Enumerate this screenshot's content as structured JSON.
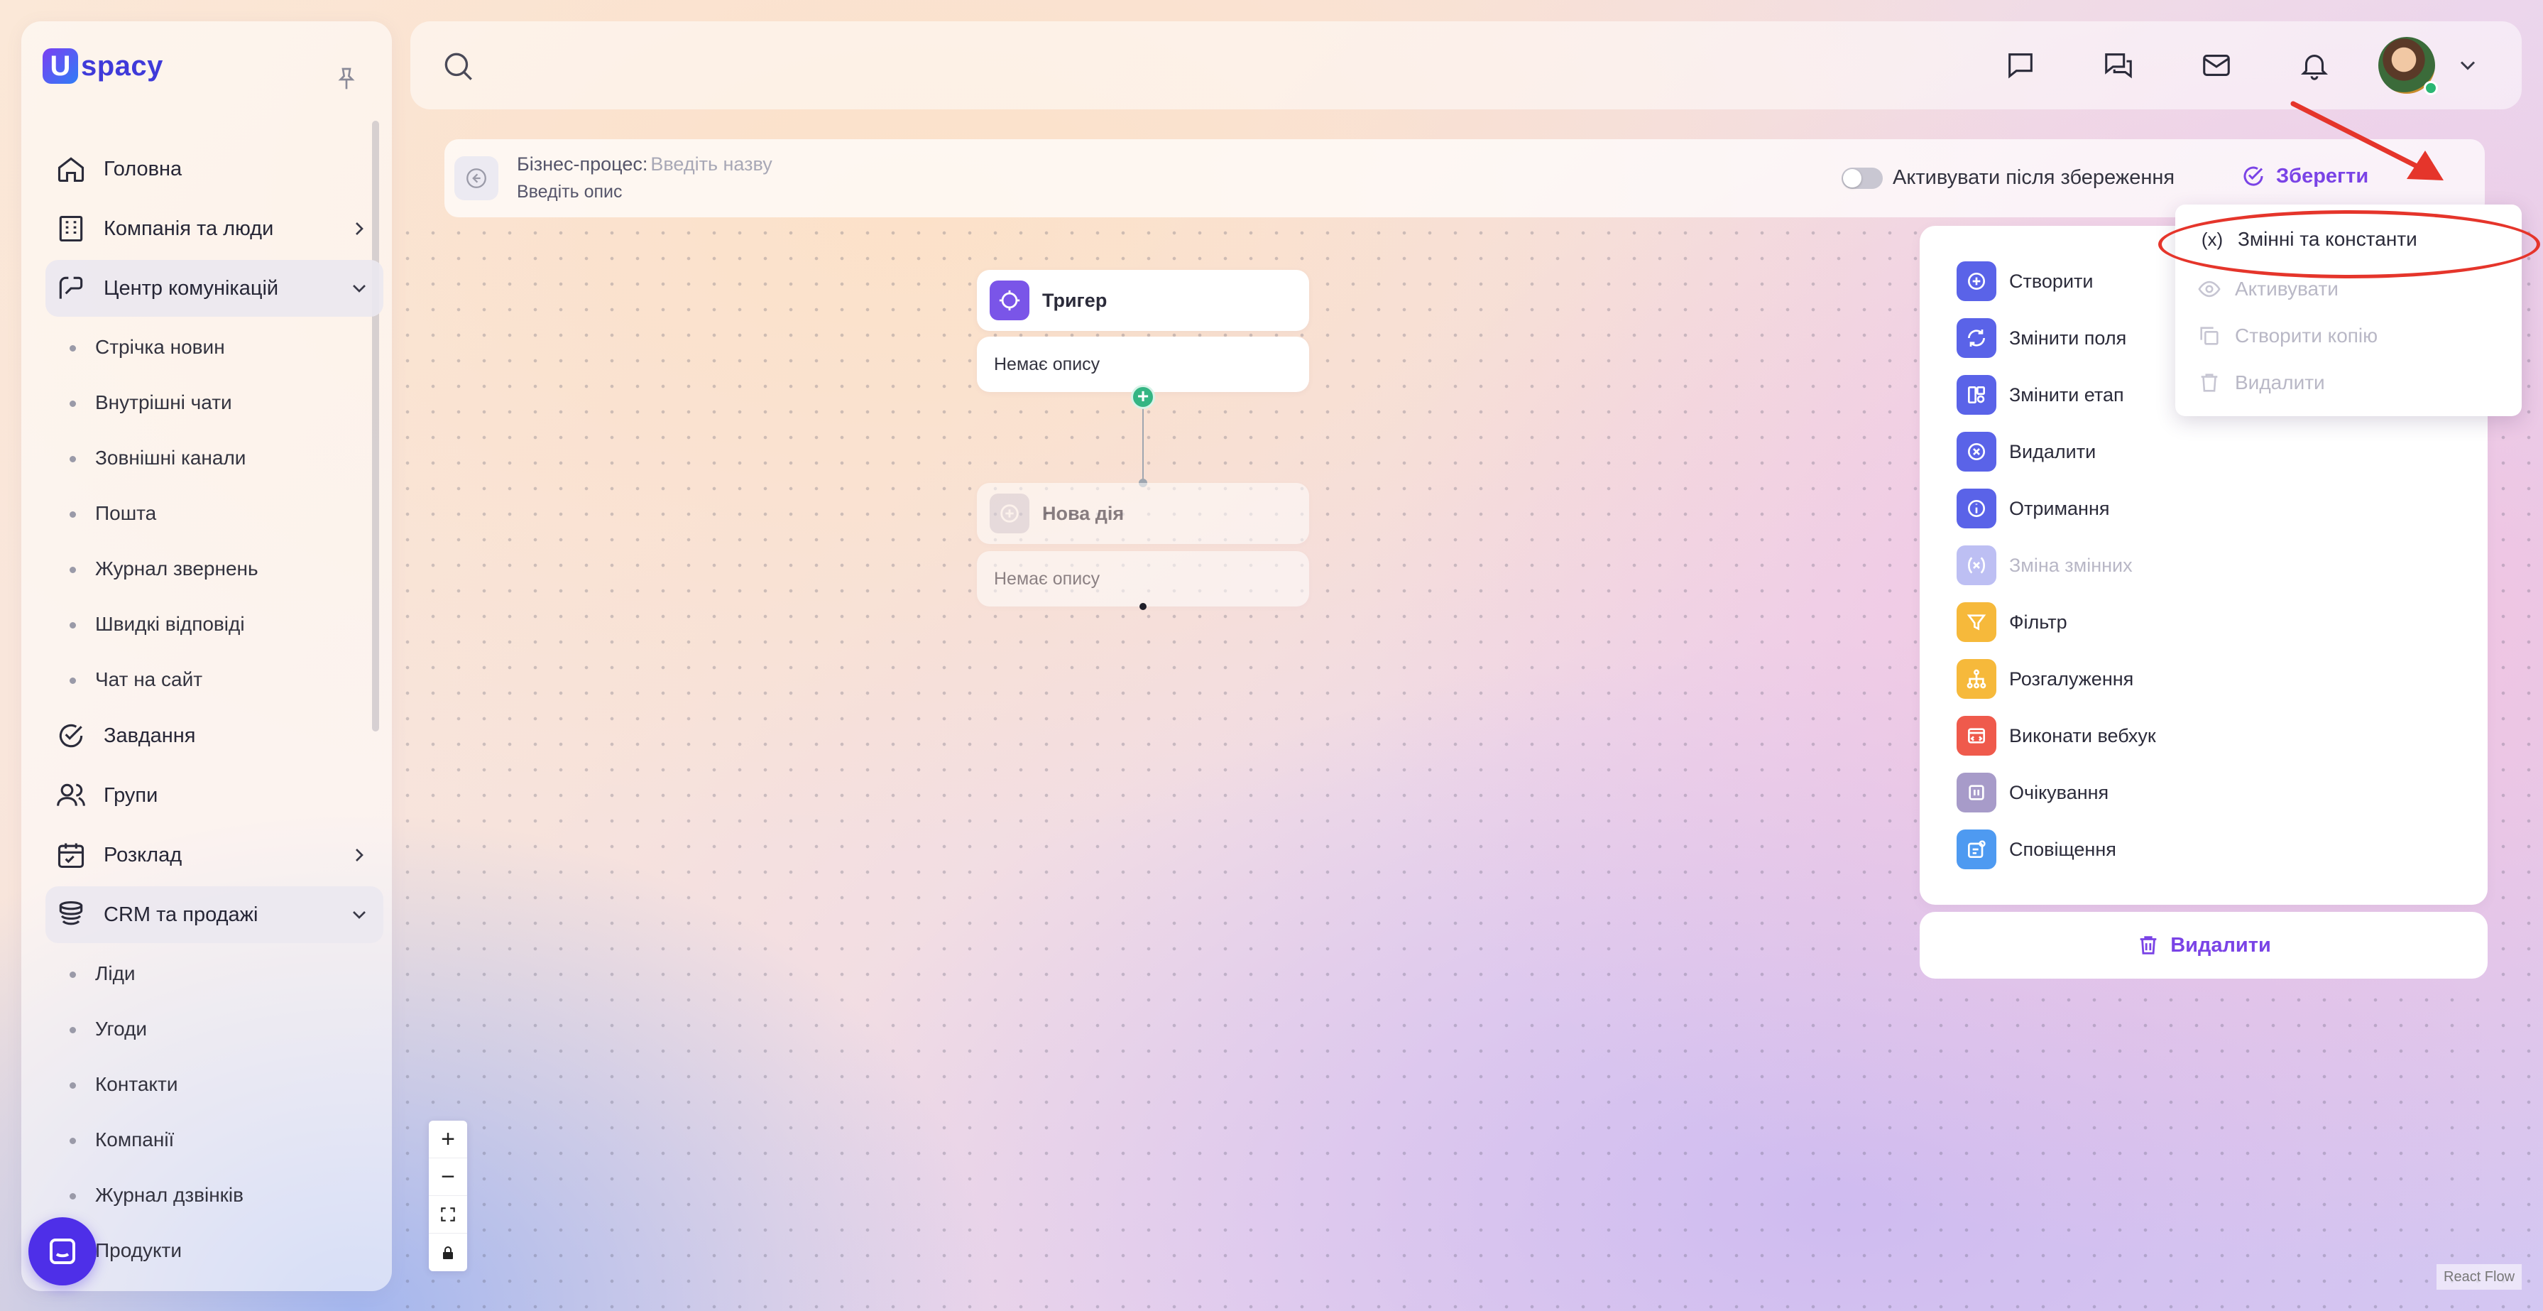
{
  "app": {
    "logo_text": "spacy",
    "logo_letter": "U"
  },
  "sidebar": {
    "items": [
      {
        "label": "Головна",
        "icon": "home-icon"
      },
      {
        "label": "Компанія та люди",
        "icon": "building-icon",
        "expandable": true
      },
      {
        "label": "Центр комунікацій",
        "icon": "communication-icon",
        "expanded": true
      },
      {
        "label": "Стрічка новин",
        "sub": true
      },
      {
        "label": "Внутрішні чати",
        "sub": true
      },
      {
        "label": "Зовнішні канали",
        "sub": true
      },
      {
        "label": "Пошта",
        "sub": true
      },
      {
        "label": "Журнал звернень",
        "sub": true
      },
      {
        "label": "Швидкі відповіді",
        "sub": true
      },
      {
        "label": "Чат на сайт",
        "sub": true
      },
      {
        "label": "Завдання",
        "icon": "task-check-icon"
      },
      {
        "label": "Групи",
        "icon": "group-icon"
      },
      {
        "label": "Розклад",
        "icon": "calendar-icon",
        "expandable": true
      },
      {
        "label": "CRM та продажі",
        "icon": "coins-icon",
        "expanded": true
      },
      {
        "label": "Ліди",
        "sub": true
      },
      {
        "label": "Угоди",
        "sub": true
      },
      {
        "label": "Контакти",
        "sub": true
      },
      {
        "label": "Компанії",
        "sub": true
      },
      {
        "label": "Журнал дзвінків",
        "sub": true
      },
      {
        "label": "Продукти",
        "sub": true
      }
    ]
  },
  "process": {
    "label": "Бізнес-процес:",
    "name_placeholder": "Введіть назву",
    "description_placeholder": "Введіть опис",
    "activate_toggle_label": "Активувати після збереження",
    "save_label": "Зберегти"
  },
  "flow": {
    "trigger": {
      "title": "Тригер",
      "description": "Немає опису"
    },
    "new_action": {
      "title": "Нова дія",
      "description": "Немає опису"
    }
  },
  "actions_panel": {
    "items": [
      {
        "label": "Створити",
        "icon": "plus-circle-icon",
        "color": "#5a63e8"
      },
      {
        "label": "Змінити поля",
        "icon": "refresh-icon",
        "color": "#5a63e8"
      },
      {
        "label": "Змінити етап",
        "icon": "stage-icon",
        "color": "#5a63e8"
      },
      {
        "label": "Видалити",
        "icon": "x-circle-icon",
        "color": "#5a63e8"
      },
      {
        "label": "Отримання",
        "icon": "info-icon",
        "color": "#5a63e8"
      },
      {
        "label": "Зміна змінних",
        "icon": "variable-icon",
        "color": "#bdbff3",
        "disabled": true
      },
      {
        "label": "Фільтр",
        "icon": "filter-icon",
        "color": "#f6b93b"
      },
      {
        "label": "Розгалуження",
        "icon": "branch-icon",
        "color": "#f6b93b"
      },
      {
        "label": "Виконати вебхук",
        "icon": "webhook-icon",
        "color": "#ef5a4c"
      },
      {
        "label": "Очікування",
        "icon": "pause-icon",
        "color": "#a79bc9"
      },
      {
        "label": "Сповіщення",
        "icon": "notification-icon",
        "color": "#4e9af1"
      }
    ],
    "delete_label": "Видалити"
  },
  "menu": {
    "items": [
      {
        "label": "Змінні та константи",
        "icon": "(x)"
      },
      {
        "label": "Активувати",
        "icon": "eye-icon",
        "disabled": true
      },
      {
        "label": "Створити копію",
        "icon": "copy-icon",
        "disabled": true
      },
      {
        "label": "Видалити",
        "icon": "trash-icon",
        "disabled": true
      }
    ]
  },
  "zoom": {
    "plus": "+",
    "minus": "−"
  },
  "attribution": "React Flow",
  "colors": {
    "accent": "#7a43e6",
    "annotation": "#e5352b",
    "brand": "#3f3ad9"
  }
}
